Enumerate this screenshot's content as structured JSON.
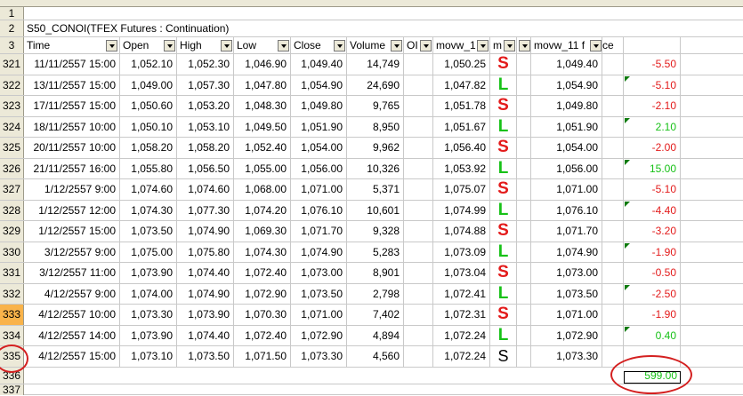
{
  "sheet": {
    "row_numbers": {
      "r1": "1",
      "r2": "2",
      "r3": "3",
      "r336": "336",
      "r337": "337"
    },
    "title": "S50_CONOI(TFEX Futures : Continuation)",
    "headers": {
      "time": "Time",
      "open": "Open",
      "high": "High",
      "low": "Low",
      "close": "Close",
      "volume": "Volume",
      "oi": "OI",
      "movw": "movw_1",
      "m": "m",
      "movw11": "movw_11 f",
      "movw11_tail": "ce"
    },
    "rows": [
      {
        "n": "321",
        "time": "11/11/2557 15:00",
        "open": "1,052.10",
        "high": "1,052.30",
        "low": "1,046.90",
        "close": "1,049.40",
        "volume": "14,749",
        "movw": "1,050.25",
        "sig": "S",
        "price": "1,049.40",
        "pl": "-5.50"
      },
      {
        "n": "322",
        "time": "13/11/2557 15:00",
        "open": "1,049.00",
        "high": "1,057.30",
        "low": "1,047.80",
        "close": "1,054.90",
        "volume": "24,690",
        "movw": "1,047.82",
        "sig": "L",
        "price": "1,054.90",
        "pl": "-5.10"
      },
      {
        "n": "323",
        "time": "17/11/2557 15:00",
        "open": "1,050.60",
        "high": "1,053.20",
        "low": "1,048.30",
        "close": "1,049.80",
        "volume": "9,765",
        "movw": "1,051.78",
        "sig": "S",
        "price": "1,049.80",
        "pl": "-2.10"
      },
      {
        "n": "324",
        "time": "18/11/2557 10:00",
        "open": "1,050.10",
        "high": "1,053.10",
        "low": "1,049.50",
        "close": "1,051.90",
        "volume": "8,950",
        "movw": "1,051.67",
        "sig": "L",
        "price": "1,051.90",
        "pl": "2.10"
      },
      {
        "n": "325",
        "time": "20/11/2557 10:00",
        "open": "1,058.20",
        "high": "1,058.20",
        "low": "1,052.40",
        "close": "1,054.00",
        "volume": "9,962",
        "movw": "1,056.40",
        "sig": "S",
        "price": "1,054.00",
        "pl": "-2.00"
      },
      {
        "n": "326",
        "time": "21/11/2557 16:00",
        "open": "1,055.80",
        "high": "1,056.50",
        "low": "1,055.00",
        "close": "1,056.00",
        "volume": "10,326",
        "movw": "1,053.92",
        "sig": "L",
        "price": "1,056.00",
        "pl": "15.00"
      },
      {
        "n": "327",
        "time": "1/12/2557 9:00",
        "open": "1,074.60",
        "high": "1,074.60",
        "low": "1,068.00",
        "close": "1,071.00",
        "volume": "5,371",
        "movw": "1,075.07",
        "sig": "S",
        "price": "1,071.00",
        "pl": "-5.10"
      },
      {
        "n": "328",
        "time": "1/12/2557 12:00",
        "open": "1,074.30",
        "high": "1,077.30",
        "low": "1,074.20",
        "close": "1,076.10",
        "volume": "10,601",
        "movw": "1,074.99",
        "sig": "L",
        "price": "1,076.10",
        "pl": "-4.40"
      },
      {
        "n": "329",
        "time": "1/12/2557 15:00",
        "open": "1,073.50",
        "high": "1,074.90",
        "low": "1,069.30",
        "close": "1,071.70",
        "volume": "9,328",
        "movw": "1,074.88",
        "sig": "S",
        "price": "1,071.70",
        "pl": "-3.20"
      },
      {
        "n": "330",
        "time": "3/12/2557 9:00",
        "open": "1,075.00",
        "high": "1,075.80",
        "low": "1,074.30",
        "close": "1,074.90",
        "volume": "5,283",
        "movw": "1,073.09",
        "sig": "L",
        "price": "1,074.90",
        "pl": "-1.90"
      },
      {
        "n": "331",
        "time": "3/12/2557 11:00",
        "open": "1,073.90",
        "high": "1,074.40",
        "low": "1,072.40",
        "close": "1,073.00",
        "volume": "8,901",
        "movw": "1,073.04",
        "sig": "S",
        "price": "1,073.00",
        "pl": "-0.50"
      },
      {
        "n": "332",
        "time": "4/12/2557 9:00",
        "open": "1,074.00",
        "high": "1,074.90",
        "low": "1,072.90",
        "close": "1,073.50",
        "volume": "2,798",
        "movw": "1,072.41",
        "sig": "L",
        "price": "1,073.50",
        "pl": "-2.50"
      },
      {
        "n": "333",
        "time": "4/12/2557 10:00",
        "open": "1,073.30",
        "high": "1,073.90",
        "low": "1,070.30",
        "close": "1,071.00",
        "volume": "7,402",
        "movw": "1,072.31",
        "sig": "S",
        "price": "1,071.00",
        "pl": "-1.90"
      },
      {
        "n": "334",
        "time": "4/12/2557 14:00",
        "open": "1,073.90",
        "high": "1,074.40",
        "low": "1,072.40",
        "close": "1,072.90",
        "volume": "4,894",
        "movw": "1,072.24",
        "sig": "L",
        "price": "1,072.90",
        "pl": "0.40"
      },
      {
        "n": "335",
        "time": "4/12/2557 15:00",
        "open": "1,073.10",
        "high": "1,073.50",
        "low": "1,071.50",
        "close": "1,073.30",
        "volume": "4,560",
        "movw": "1,072.24",
        "sig": "S",
        "price": "1,073.30",
        "pl": ""
      }
    ],
    "total": "599.00",
    "colors": {
      "signal_short": "#e31b1b",
      "signal_long": "#17c117",
      "negative": "#e31b1b",
      "positive": "#17c117",
      "selected_row_header": "#f9b34a",
      "annotation": "#d42020"
    }
  }
}
